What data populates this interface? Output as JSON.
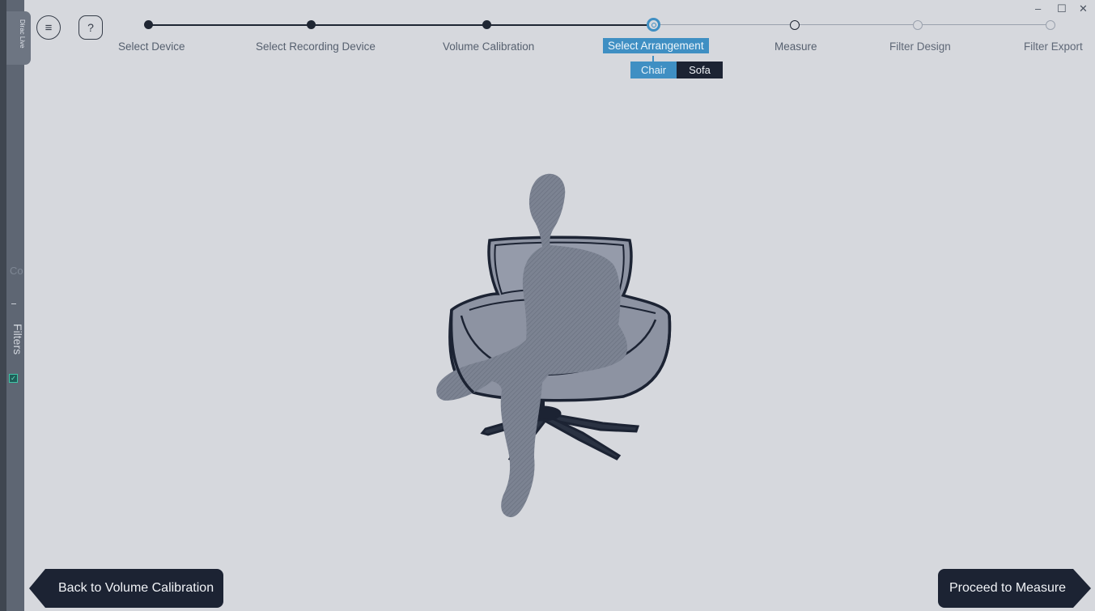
{
  "app": {
    "sidebar_tab_label": "Dirac Live",
    "sidebar_ghost_label": "Co",
    "sidebar_filters_label": "Filters"
  },
  "toolbar": {
    "menu_icon": "≡",
    "help_icon": "?"
  },
  "window_controls": {
    "minimize": "–",
    "maximize": "☐",
    "close": "✕"
  },
  "steps": [
    {
      "label": "Select Device",
      "state": "done"
    },
    {
      "label": "Select Recording Device",
      "state": "done"
    },
    {
      "label": "Volume Calibration",
      "state": "done"
    },
    {
      "label": "Select Arrangement",
      "state": "current"
    },
    {
      "label": "Measure",
      "state": "next"
    },
    {
      "label": "Filter Design",
      "state": "future"
    },
    {
      "label": "Filter Export",
      "state": "future"
    }
  ],
  "arrangement": {
    "options": [
      {
        "label": "Chair",
        "selected": true
      },
      {
        "label": "Sofa",
        "selected": false
      }
    ]
  },
  "illustration": {
    "icon": "person-in-chair-icon"
  },
  "navigation": {
    "back_label": "Back to Volume Calibration",
    "proceed_label": "Proceed to Measure"
  },
  "colors": {
    "background": "#d6d8dd",
    "accent": "#3f8fc3",
    "dark": "#1c2333",
    "rail": "#5e6673"
  }
}
